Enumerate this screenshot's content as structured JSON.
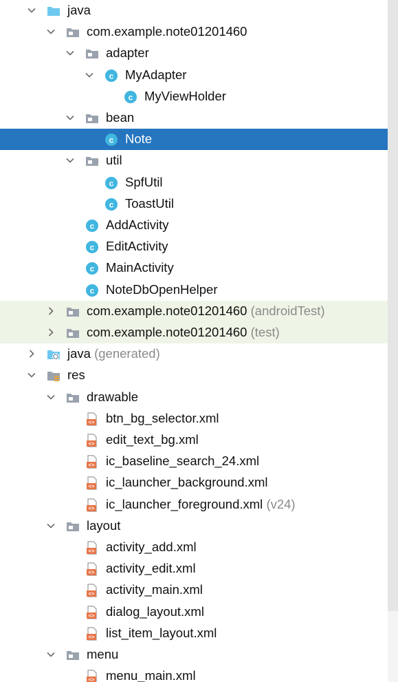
{
  "colors": {
    "selection": "#2675bf",
    "test_background": "#eef5e6",
    "folder_blue": "#6ec8f0",
    "folder_gray": "#9aa3ad",
    "class_circle": "#40b6e0",
    "xml_orange": "#e8764a",
    "suffix_gray": "#8a8a8a"
  },
  "tree": {
    "rows": [
      {
        "label": "java",
        "suffix": "",
        "depth": 1,
        "expand": "open",
        "icon": "source-folder-icon",
        "highlight": ""
      },
      {
        "label": "com.example.note01201460",
        "suffix": "",
        "depth": 2,
        "expand": "open",
        "icon": "package-folder-icon",
        "highlight": ""
      },
      {
        "label": "adapter",
        "suffix": "",
        "depth": 3,
        "expand": "open",
        "icon": "package-folder-icon",
        "highlight": ""
      },
      {
        "label": "MyAdapter",
        "suffix": "",
        "depth": 4,
        "expand": "open",
        "icon": "class-icon",
        "highlight": ""
      },
      {
        "label": "MyViewHolder",
        "suffix": "",
        "depth": 5,
        "expand": "none",
        "icon": "class-icon",
        "highlight": ""
      },
      {
        "label": "bean",
        "suffix": "",
        "depth": 3,
        "expand": "open",
        "icon": "package-folder-icon",
        "highlight": ""
      },
      {
        "label": "Note",
        "suffix": "",
        "depth": 4,
        "expand": "none",
        "icon": "class-icon",
        "highlight": "selected"
      },
      {
        "label": "util",
        "suffix": "",
        "depth": 3,
        "expand": "open",
        "icon": "package-folder-icon",
        "highlight": ""
      },
      {
        "label": "SpfUtil",
        "suffix": "",
        "depth": 4,
        "expand": "none",
        "icon": "class-icon",
        "highlight": ""
      },
      {
        "label": "ToastUtil",
        "suffix": "",
        "depth": 4,
        "expand": "none",
        "icon": "class-icon",
        "highlight": ""
      },
      {
        "label": "AddActivity",
        "suffix": "",
        "depth": 3,
        "expand": "none",
        "icon": "class-icon",
        "highlight": ""
      },
      {
        "label": "EditActivity",
        "suffix": "",
        "depth": 3,
        "expand": "none",
        "icon": "class-icon",
        "highlight": ""
      },
      {
        "label": "MainActivity",
        "suffix": "",
        "depth": 3,
        "expand": "none",
        "icon": "class-icon",
        "highlight": ""
      },
      {
        "label": "NoteDbOpenHelper",
        "suffix": "",
        "depth": 3,
        "expand": "none",
        "icon": "class-icon",
        "highlight": ""
      },
      {
        "label": "com.example.note01201460",
        "suffix": "(androidTest)",
        "depth": 2,
        "expand": "closed",
        "icon": "package-folder-icon",
        "highlight": "test"
      },
      {
        "label": "com.example.note01201460",
        "suffix": "(test)",
        "depth": 2,
        "expand": "closed",
        "icon": "package-folder-icon",
        "highlight": "test"
      },
      {
        "label": "java",
        "suffix": "(generated)",
        "depth": 1,
        "expand": "closed",
        "icon": "generated-source-folder-icon",
        "highlight": ""
      },
      {
        "label": "res",
        "suffix": "",
        "depth": 1,
        "expand": "open",
        "icon": "resource-folder-icon",
        "highlight": ""
      },
      {
        "label": "drawable",
        "suffix": "",
        "depth": 2,
        "expand": "open",
        "icon": "package-folder-icon",
        "highlight": ""
      },
      {
        "label": "btn_bg_selector.xml",
        "suffix": "",
        "depth": 3,
        "expand": "none",
        "icon": "xml-file-icon",
        "highlight": ""
      },
      {
        "label": "edit_text_bg.xml",
        "suffix": "",
        "depth": 3,
        "expand": "none",
        "icon": "xml-file-icon",
        "highlight": ""
      },
      {
        "label": "ic_baseline_search_24.xml",
        "suffix": "",
        "depth": 3,
        "expand": "none",
        "icon": "xml-file-icon",
        "highlight": ""
      },
      {
        "label": "ic_launcher_background.xml",
        "suffix": "",
        "depth": 3,
        "expand": "none",
        "icon": "xml-file-icon",
        "highlight": ""
      },
      {
        "label": "ic_launcher_foreground.xml",
        "suffix": "(v24)",
        "depth": 3,
        "expand": "none",
        "icon": "xml-file-icon",
        "highlight": ""
      },
      {
        "label": "layout",
        "suffix": "",
        "depth": 2,
        "expand": "open",
        "icon": "package-folder-icon",
        "highlight": ""
      },
      {
        "label": "activity_add.xml",
        "suffix": "",
        "depth": 3,
        "expand": "none",
        "icon": "xml-file-icon",
        "highlight": ""
      },
      {
        "label": "activity_edit.xml",
        "suffix": "",
        "depth": 3,
        "expand": "none",
        "icon": "xml-file-icon",
        "highlight": ""
      },
      {
        "label": "activity_main.xml",
        "suffix": "",
        "depth": 3,
        "expand": "none",
        "icon": "xml-file-icon",
        "highlight": ""
      },
      {
        "label": "dialog_layout.xml",
        "suffix": "",
        "depth": 3,
        "expand": "none",
        "icon": "xml-file-icon",
        "highlight": ""
      },
      {
        "label": "list_item_layout.xml",
        "suffix": "",
        "depth": 3,
        "expand": "none",
        "icon": "xml-file-icon",
        "highlight": ""
      },
      {
        "label": "menu",
        "suffix": "",
        "depth": 2,
        "expand": "open",
        "icon": "package-folder-icon",
        "highlight": ""
      },
      {
        "label": "menu_main.xml",
        "suffix": "",
        "depth": 3,
        "expand": "none",
        "icon": "xml-file-icon",
        "highlight": ""
      }
    ]
  }
}
